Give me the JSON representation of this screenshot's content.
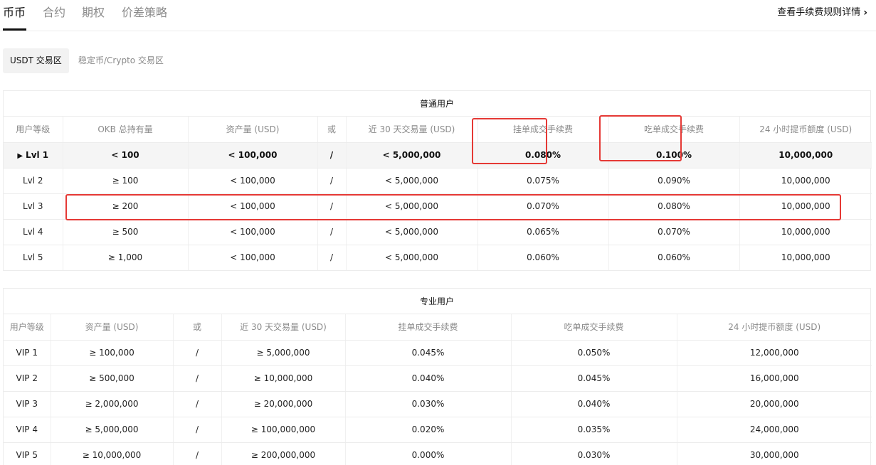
{
  "tabs": [
    {
      "label": "币币",
      "active": true
    },
    {
      "label": "合约",
      "active": false
    },
    {
      "label": "期权",
      "active": false
    },
    {
      "label": "价差策略",
      "active": false
    }
  ],
  "fee_link": {
    "label": "查看手续费规则详情",
    "icon": "chevron-right-icon"
  },
  "subtabs": [
    {
      "label": "USDT 交易区",
      "active": true
    },
    {
      "label": "稳定币/Crypto 交易区",
      "active": false
    }
  ],
  "regular": {
    "title": "普通用户",
    "headers": [
      "用户等级",
      "OKB 总持有量",
      "资产量 (USD)",
      "或",
      "近 30 天交易量 (USD)",
      "挂单成交手续费",
      "吃单成交手续费",
      "24 小时提币额度 (USD)"
    ],
    "rows": [
      {
        "level": "Lvl 1",
        "okb": "< 100",
        "assets": "< 100,000",
        "or": "/",
        "volume": "< 5,000,000",
        "maker": "0.080%",
        "taker": "0.100%",
        "withdraw": "10,000,000",
        "current": true
      },
      {
        "level": "Lvl 2",
        "okb": "≥ 100",
        "assets": "< 100,000",
        "or": "/",
        "volume": "< 5,000,000",
        "maker": "0.075%",
        "taker": "0.090%",
        "withdraw": "10,000,000",
        "current": false
      },
      {
        "level": "Lvl 3",
        "okb": "≥ 200",
        "assets": "< 100,000",
        "or": "/",
        "volume": "< 5,000,000",
        "maker": "0.070%",
        "taker": "0.080%",
        "withdraw": "10,000,000",
        "current": false
      },
      {
        "level": "Lvl 4",
        "okb": "≥ 500",
        "assets": "< 100,000",
        "or": "/",
        "volume": "< 5,000,000",
        "maker": "0.065%",
        "taker": "0.070%",
        "withdraw": "10,000,000",
        "current": false
      },
      {
        "level": "Lvl 5",
        "okb": "≥ 1,000",
        "assets": "< 100,000",
        "or": "/",
        "volume": "< 5,000,000",
        "maker": "0.060%",
        "taker": "0.060%",
        "withdraw": "10,000,000",
        "current": false
      }
    ]
  },
  "pro": {
    "title": "专业用户",
    "headers": [
      "用户等级",
      "资产量 (USD)",
      "或",
      "近 30 天交易量 (USD)",
      "挂单成交手续费",
      "吃单成交手续费",
      "24 小时提币额度 (USD)"
    ],
    "rows": [
      {
        "level": "VIP 1",
        "assets": "≥ 100,000",
        "or": "/",
        "volume": "≥ 5,000,000",
        "maker": "0.045%",
        "taker": "0.050%",
        "withdraw": "12,000,000"
      },
      {
        "level": "VIP 2",
        "assets": "≥ 500,000",
        "or": "/",
        "volume": "≥ 10,000,000",
        "maker": "0.040%",
        "taker": "0.045%",
        "withdraw": "16,000,000"
      },
      {
        "level": "VIP 3",
        "assets": "≥ 2,000,000",
        "or": "/",
        "volume": "≥ 20,000,000",
        "maker": "0.030%",
        "taker": "0.040%",
        "withdraw": "20,000,000"
      },
      {
        "level": "VIP 4",
        "assets": "≥ 5,000,000",
        "or": "/",
        "volume": "≥ 100,000,000",
        "maker": "0.020%",
        "taker": "0.035%",
        "withdraw": "24,000,000"
      },
      {
        "level": "VIP 5",
        "assets": "≥ 10,000,000",
        "or": "/",
        "volume": "≥ 200,000,000",
        "maker": "0.000%",
        "taker": "0.030%",
        "withdraw": "30,000,000"
      }
    ]
  },
  "colors": {
    "highlight": "#e53935",
    "accent": "#111111",
    "muted": "#8a8a8a"
  }
}
